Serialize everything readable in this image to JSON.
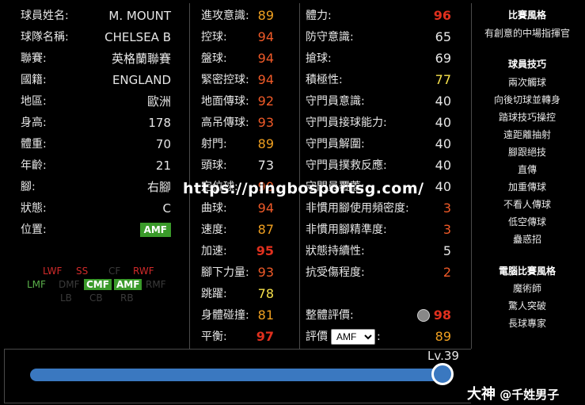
{
  "profile": {
    "rows": [
      {
        "label": "球員姓名:",
        "value": "M. MOUNT"
      },
      {
        "label": "球隊名稱:",
        "value": "CHELSEA B"
      },
      {
        "label": "聯賽:",
        "value": "英格蘭聯賽"
      },
      {
        "label": "國籍:",
        "value": "ENGLAND"
      },
      {
        "label": "地區:",
        "value": "歐洲"
      },
      {
        "label": "身高:",
        "value": "178"
      },
      {
        "label": "體重:",
        "value": "70"
      },
      {
        "label": "年齡:",
        "value": "21"
      },
      {
        "label": "腳:",
        "value": "右腳"
      },
      {
        "label": "狀態:",
        "value": "C"
      }
    ],
    "position_label": "位置:",
    "position_value": "AMF",
    "pos_map": {
      "lwf": "LWF",
      "ss": "SS",
      "cf": "CF",
      "rwf": "RWF",
      "lmf": "LMF",
      "dmf": "DMF",
      "cmf": "CMF",
      "amf": "AMF",
      "rmf": "RMF",
      "lb": "LB",
      "cb": "CB",
      "rb": "RB"
    }
  },
  "stats_a": [
    {
      "label": "進攻意識:",
      "value": "89",
      "tone": "orange"
    },
    {
      "label": "控球:",
      "value": "94",
      "tone": "orangered"
    },
    {
      "label": "盤球:",
      "value": "94",
      "tone": "orangered"
    },
    {
      "label": "緊密控球:",
      "value": "94",
      "tone": "orangered"
    },
    {
      "label": "地面傳球:",
      "value": "92",
      "tone": "orangered"
    },
    {
      "label": "高吊傳球:",
      "value": "93",
      "tone": "orangered"
    },
    {
      "label": "射門:",
      "value": "89",
      "tone": "orange"
    },
    {
      "label": "頭球:",
      "value": "73",
      "tone": "white"
    },
    {
      "label": "定位球:",
      "value": "90",
      "tone": "orangered"
    },
    {
      "label": "曲球:",
      "value": "94",
      "tone": "orangered"
    },
    {
      "label": "速度:",
      "value": "87",
      "tone": "orange"
    },
    {
      "label": "加速:",
      "value": "95",
      "tone": "red"
    },
    {
      "label": "腳下力量:",
      "value": "93",
      "tone": "orangered"
    },
    {
      "label": "跳躍:",
      "value": "78",
      "tone": "yellow"
    },
    {
      "label": "身體碰撞:",
      "value": "81",
      "tone": "orange"
    },
    {
      "label": "平衡:",
      "value": "97",
      "tone": "red"
    }
  ],
  "stats_b": [
    {
      "label": "體力:",
      "value": "96",
      "tone": "red"
    },
    {
      "label": "防守意識:",
      "value": "65",
      "tone": "white"
    },
    {
      "label": "搶球:",
      "value": "69",
      "tone": "white"
    },
    {
      "label": "積極性:",
      "value": "77",
      "tone": "yellow"
    },
    {
      "label": "守門員意識:",
      "value": "40",
      "tone": "white"
    },
    {
      "label": "守門員接球能力:",
      "value": "40",
      "tone": "white"
    },
    {
      "label": "守門員解圍:",
      "value": "40",
      "tone": "white"
    },
    {
      "label": "守門員撲救反應:",
      "value": "40",
      "tone": "white"
    },
    {
      "label": "守門員覆蓋:",
      "value": "40",
      "tone": "white"
    },
    {
      "label": "非慣用腳使用頻密度:",
      "value": "3",
      "tone": "orangered"
    },
    {
      "label": "非慣用腳精準度:",
      "value": "3",
      "tone": "orangered"
    },
    {
      "label": "狀態持續性:",
      "value": "5",
      "tone": "white"
    },
    {
      "label": "抗受傷程度:",
      "value": "2",
      "tone": "orangered"
    }
  ],
  "overall": {
    "label": "整體評價:",
    "value": "98"
  },
  "rating": {
    "label": "評價",
    "selected": "AMF",
    "value": "89"
  },
  "side": {
    "style_heading": "比賽風格",
    "style_value": "有創意的中場指揮官",
    "skills_heading": "球員技巧",
    "skills": [
      "兩次觸球",
      "向後切球並轉身",
      "踏球技巧操控",
      "遠距離抽射",
      "腳跟絕技",
      "直傳",
      "加重傳球",
      "不看人傳球",
      "低空傳球",
      "蠱惑招"
    ],
    "ai_heading": "電腦比賽風格",
    "ai_styles": [
      "魔術師",
      "驚人突破",
      "長球專家"
    ]
  },
  "level": {
    "label": "Lv.39",
    "fraction": 1.0
  },
  "watermark": "https://pingbosportsg.com/",
  "credit": {
    "big": "大神",
    "text": "@千姓男子"
  },
  "colors": {
    "red": "#e0301e",
    "orangered": "#f05a28",
    "orange": "#f0a020",
    "yellow": "#f7e14b",
    "green": "#3a9a2a",
    "blue": "#3a78c0"
  }
}
